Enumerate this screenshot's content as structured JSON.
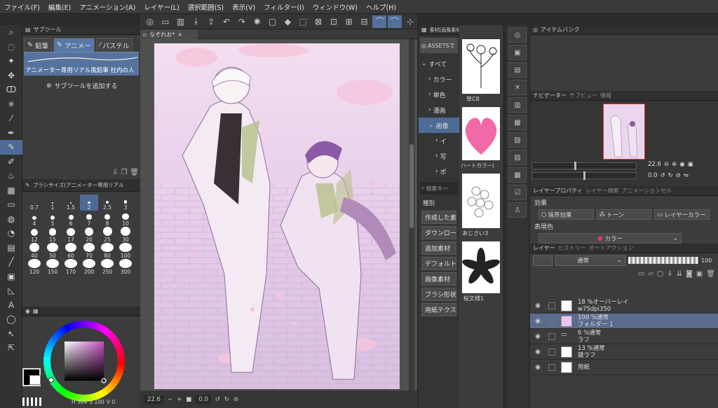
{
  "menu": [
    "ファイル(F)",
    "編集(E)",
    "アニメーション(A)",
    "レイヤー(L)",
    "選択範囲(S)",
    "表示(V)",
    "フィルター(I)",
    "ウィンドウ(W)",
    "ヘルプ(H)"
  ],
  "subtool_panel": {
    "title": "サブツール",
    "tabs": [
      "鉛筆",
      "アニメー",
      "パステル"
    ],
    "selected_item": "アニメーター専用リアル風鉛筆 社内の人",
    "add_label": "サブツールを追加する"
  },
  "brush_panel": {
    "title": "ブラシサイズ(アニメーター専用リアル",
    "sizes": [
      "0.7",
      "1",
      "1.5",
      "2",
      "2.5",
      "3",
      "4",
      "5",
      "6",
      "7",
      "8",
      "10",
      "12",
      "15",
      "17",
      "20",
      "25",
      "30",
      "40",
      "50",
      "60",
      "70",
      "80",
      "100",
      "120",
      "150",
      "170",
      "200",
      "250",
      "300"
    ],
    "selected": "2"
  },
  "color": {
    "readout_h": "H 304",
    "readout_s": "S 100",
    "readout_v": "V 0",
    "primary": "#000000",
    "secondary": "#ffffff",
    "hue_color": "#c34fc0"
  },
  "canvas": {
    "tab_label": "なぞれお*",
    "zoom": "22.6",
    "angle": "0.0"
  },
  "materials": {
    "title": "素材[画像素材]",
    "assets_label": "ASSETSで",
    "tree": [
      "すべて",
      "カラー",
      "単色",
      "漫画",
      "画像",
      "イ",
      "写",
      "ポ"
    ],
    "search_placeholder": "検索キー",
    "categories_header": "種別",
    "buttons": [
      "作成した素",
      "ダウンロード",
      "追加素材",
      "デフォルト",
      "画像素材",
      "ブラシ形状",
      "用紙テクスチ"
    ],
    "items": [
      "草C8",
      "ハートカラー(",
      "あじさい3",
      "桜文様1"
    ]
  },
  "item_bank": {
    "title": "アイテムバンク"
  },
  "navigator": {
    "tabs": [
      "ナビゲーター",
      "サブビュー",
      "情報"
    ],
    "zoom": "22.6",
    "angle": "0.0"
  },
  "layer_property": {
    "tabs": [
      "レイヤープロパティ",
      "レイヤー検索",
      "アニメーションセル"
    ],
    "effect_label": "効果",
    "effects": [
      "境界効果",
      "トーン",
      "レイヤーカラー"
    ],
    "expression_label": "表現色",
    "expression_value": "カラー"
  },
  "layers": {
    "tabs": [
      "レイヤー",
      "ヒストリー",
      "オートアクション"
    ],
    "blend_mode": "通常",
    "opacity": "100",
    "rows": [
      {
        "line1": "18 %オーバーレイ",
        "line2": "w75dpi350"
      },
      {
        "line1": "100 %通常",
        "line2": "フォルダー 1"
      },
      {
        "line1": "6 %通常",
        "line2": "ラフ"
      },
      {
        "line1": "13 %通常",
        "line2": "雑ラフ"
      },
      {
        "line1": "",
        "line2": "用紙"
      }
    ]
  }
}
